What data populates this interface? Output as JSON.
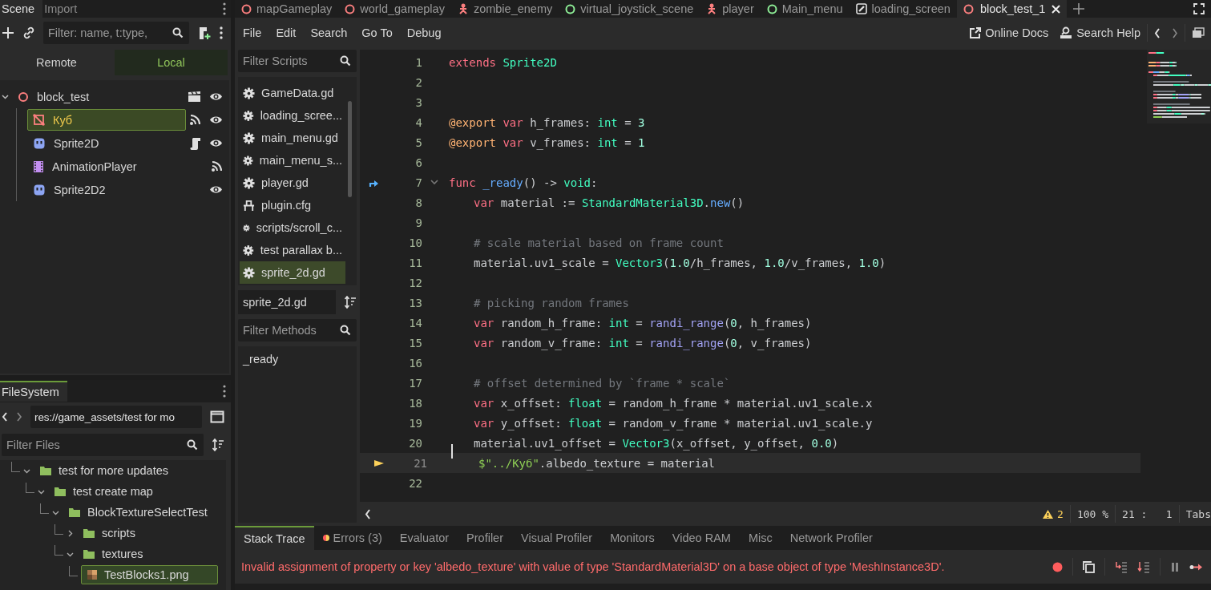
{
  "scene_dock": {
    "tabs": [
      {
        "label": "Scene",
        "selected": true
      },
      {
        "label": "Import",
        "selected": false
      }
    ],
    "filter": {
      "placeholder": "Filter: name, t:type,"
    },
    "mode_tabs": [
      {
        "label": "Remote",
        "selected": false
      },
      {
        "label": "Local",
        "selected": true
      }
    ],
    "tree": [
      {
        "label": "block_test",
        "kind": "root",
        "expanded": true,
        "selected": false,
        "instance": true,
        "signals": false,
        "script": false,
        "visible": true,
        "children": [
          {
            "label": "Куб",
            "kind": "mesh",
            "selected": true,
            "instance": false,
            "signals": true,
            "script": false,
            "visible": true
          },
          {
            "label": "Sprite2D",
            "kind": "sprite",
            "selected": false,
            "instance": false,
            "signals": false,
            "script": true,
            "visible": true
          },
          {
            "label": "AnimationPlayer",
            "kind": "animation",
            "selected": false,
            "instance": false,
            "signals": true,
            "script": false,
            "visible": false
          },
          {
            "label": "Sprite2D2",
            "kind": "sprite",
            "selected": false,
            "instance": false,
            "signals": false,
            "script": false,
            "visible": true
          }
        ]
      }
    ]
  },
  "filesystem": {
    "title": "FileSystem",
    "path": "res://game_assets/test for mo",
    "filter": {
      "placeholder": "Filter Files"
    },
    "tree": [
      {
        "label": "test for more updates",
        "kind": "folder",
        "expanded": true,
        "selected": false,
        "children": [
          {
            "label": "test create map",
            "kind": "folder",
            "expanded": true,
            "selected": false,
            "children": [
              {
                "label": "BlockTextureSelectTest",
                "kind": "folder",
                "expanded": true,
                "selected": false,
                "children": [
                  {
                    "label": "scripts",
                    "kind": "folder",
                    "expanded": false,
                    "selected": false
                  },
                  {
                    "label": "textures",
                    "kind": "folder",
                    "expanded": true,
                    "selected": false,
                    "children": [
                      {
                        "label": "TestBlocks1.png",
                        "kind": "image",
                        "selected": true
                      }
                    ]
                  }
                ]
              }
            ]
          }
        ]
      }
    ]
  },
  "scene_tabs": [
    {
      "label": "mapGameplay",
      "kind": "spatial",
      "selected": false
    },
    {
      "label": "world_gameplay",
      "kind": "spatial",
      "selected": false
    },
    {
      "label": "zombie_enemy",
      "kind": "character",
      "selected": false
    },
    {
      "label": "virtual_joystick_scene",
      "kind": "control",
      "selected": false
    },
    {
      "label": "player",
      "kind": "character",
      "selected": false
    },
    {
      "label": "Main_menu",
      "kind": "control",
      "selected": false
    },
    {
      "label": "loading_screen",
      "kind": "edit",
      "selected": false
    },
    {
      "label": "block_test_1",
      "kind": "spatial",
      "selected": true
    }
  ],
  "menu": [
    "File",
    "Edit",
    "Search",
    "Go To",
    "Debug"
  ],
  "help_links": [
    {
      "label": "Online Docs",
      "kind": "external"
    },
    {
      "label": "Search Help",
      "kind": "docs"
    }
  ],
  "scripts_panel": {
    "filter": {
      "placeholder": "Filter Scripts"
    },
    "items": [
      {
        "label": "GameData.gd",
        "kind": "script",
        "selected": false
      },
      {
        "label": "loading_scree...",
        "kind": "script",
        "selected": false
      },
      {
        "label": "main_menu.gd",
        "kind": "script",
        "selected": false
      },
      {
        "label": "main_menu_s...",
        "kind": "script",
        "selected": false
      },
      {
        "label": "player.gd",
        "kind": "script",
        "selected": false
      },
      {
        "label": "plugin.cfg",
        "kind": "config",
        "selected": false
      },
      {
        "label": "scripts/scroll_c...",
        "kind": "script",
        "selected": false
      },
      {
        "label": "test parallax b...",
        "kind": "script",
        "selected": false
      },
      {
        "label": "sprite_2d.gd",
        "kind": "script",
        "selected": true
      }
    ],
    "current": "sprite_2d.gd",
    "method_filter": {
      "placeholder": "Filter Methods"
    },
    "methods": [
      "_ready"
    ]
  },
  "editor": {
    "lines": [
      {
        "number": "1",
        "indented": false,
        "fold": false,
        "signal_connected": false,
        "executing": false,
        "tokens": [
          {
            "kind": "keyword",
            "text": "extends "
          },
          {
            "kind": "type",
            "text": "Sprite2D"
          }
        ]
      },
      {
        "number": "2",
        "fold": false,
        "signal_connected": false,
        "executing": false
      },
      {
        "number": "3",
        "fold": false,
        "signal_connected": false,
        "executing": false
      },
      {
        "number": "4",
        "indented": false,
        "fold": false,
        "signal_connected": false,
        "executing": false,
        "tokens": [
          {
            "kind": "annotation",
            "text": "@export "
          },
          {
            "kind": "keyword",
            "text": "var "
          },
          {
            "kind": "plain",
            "text": "h_frames: "
          },
          {
            "kind": "type",
            "text": "int"
          },
          {
            "kind": "plain",
            "text": " = "
          },
          {
            "kind": "number",
            "text": "3"
          }
        ]
      },
      {
        "number": "5",
        "indented": false,
        "fold": false,
        "signal_connected": false,
        "executing": false,
        "tokens": [
          {
            "kind": "annotation",
            "text": "@export "
          },
          {
            "kind": "keyword",
            "text": "var "
          },
          {
            "kind": "plain",
            "text": "v_frames: "
          },
          {
            "kind": "type",
            "text": "int"
          },
          {
            "kind": "plain",
            "text": " = "
          },
          {
            "kind": "number",
            "text": "1"
          }
        ]
      },
      {
        "number": "6",
        "fold": false,
        "signal_connected": false,
        "executing": false
      },
      {
        "number": "7",
        "indented": false,
        "fold": true,
        "signal_connected": true,
        "executing": false,
        "tokens": [
          {
            "kind": "keyword",
            "text": "func "
          },
          {
            "kind": "method",
            "text": "_ready"
          },
          {
            "kind": "plain",
            "text": "() -> "
          },
          {
            "kind": "type",
            "text": "void"
          },
          {
            "kind": "plain",
            "text": ":"
          }
        ]
      },
      {
        "number": "8",
        "indented": true,
        "fold": false,
        "signal_connected": false,
        "executing": false,
        "tokens": [
          {
            "kind": "keyword",
            "text": "var "
          },
          {
            "kind": "plain",
            "text": "material := "
          },
          {
            "kind": "type",
            "text": "StandardMaterial3D"
          },
          {
            "kind": "plain",
            "text": "."
          },
          {
            "kind": "method",
            "text": "new"
          },
          {
            "kind": "plain",
            "text": "()"
          }
        ]
      },
      {
        "number": "9",
        "fold": false,
        "signal_connected": false,
        "executing": false
      },
      {
        "number": "10",
        "indented": true,
        "fold": false,
        "signal_connected": false,
        "executing": false,
        "tokens": [
          {
            "kind": "comment",
            "text": "# scale material based on frame count"
          }
        ]
      },
      {
        "number": "11",
        "indented": true,
        "fold": false,
        "signal_connected": false,
        "executing": false,
        "tokens": [
          {
            "kind": "plain",
            "text": "material.uv1_scale = "
          },
          {
            "kind": "type",
            "text": "Vector3"
          },
          {
            "kind": "plain",
            "text": "("
          },
          {
            "kind": "number",
            "text": "1.0"
          },
          {
            "kind": "plain",
            "text": "/h_frames, "
          },
          {
            "kind": "number",
            "text": "1.0"
          },
          {
            "kind": "plain",
            "text": "/v_frames, "
          },
          {
            "kind": "number",
            "text": "1.0"
          },
          {
            "kind": "plain",
            "text": ")"
          }
        ]
      },
      {
        "number": "12",
        "fold": false,
        "signal_connected": false,
        "executing": false
      },
      {
        "number": "13",
        "indented": true,
        "fold": false,
        "signal_connected": false,
        "executing": false,
        "tokens": [
          {
            "kind": "comment",
            "text": "# picking random frames"
          }
        ]
      },
      {
        "number": "14",
        "indented": true,
        "fold": false,
        "signal_connected": false,
        "executing": false,
        "tokens": [
          {
            "kind": "keyword",
            "text": "var "
          },
          {
            "kind": "plain",
            "text": "random_h_frame: "
          },
          {
            "kind": "type",
            "text": "int"
          },
          {
            "kind": "plain",
            "text": " = "
          },
          {
            "kind": "builtin",
            "text": "randi_range"
          },
          {
            "kind": "plain",
            "text": "("
          },
          {
            "kind": "number",
            "text": "0"
          },
          {
            "kind": "plain",
            "text": ", h_frames)"
          }
        ]
      },
      {
        "number": "15",
        "indented": true,
        "fold": false,
        "signal_connected": false,
        "executing": false,
        "tokens": [
          {
            "kind": "keyword",
            "text": "var "
          },
          {
            "kind": "plain",
            "text": "random_v_frame: "
          },
          {
            "kind": "type",
            "text": "int"
          },
          {
            "kind": "plain",
            "text": " = "
          },
          {
            "kind": "builtin",
            "text": "randi_range"
          },
          {
            "kind": "plain",
            "text": "("
          },
          {
            "kind": "number",
            "text": "0"
          },
          {
            "kind": "plain",
            "text": ", v_frames)"
          }
        ]
      },
      {
        "number": "16",
        "fold": false,
        "signal_connected": false,
        "executing": false
      },
      {
        "number": "17",
        "indented": true,
        "fold": false,
        "signal_connected": false,
        "executing": false,
        "tokens": [
          {
            "kind": "comment",
            "text": "# offset determined by `frame * scale`"
          }
        ]
      },
      {
        "number": "18",
        "indented": true,
        "fold": false,
        "signal_connected": false,
        "executing": false,
        "tokens": [
          {
            "kind": "keyword",
            "text": "var "
          },
          {
            "kind": "plain",
            "text": "x_offset: "
          },
          {
            "kind": "type",
            "text": "float"
          },
          {
            "kind": "plain",
            "text": " = random_h_frame * material.uv1_scale.x"
          }
        ]
      },
      {
        "number": "19",
        "indented": true,
        "fold": false,
        "signal_connected": false,
        "executing": false,
        "tokens": [
          {
            "kind": "keyword",
            "text": "var "
          },
          {
            "kind": "plain",
            "text": "y_offset: "
          },
          {
            "kind": "type",
            "text": "float"
          },
          {
            "kind": "plain",
            "text": " = random_v_frame * material.uv1_scale.y"
          }
        ]
      },
      {
        "number": "20",
        "indented": true,
        "fold": false,
        "signal_connected": false,
        "executing": false,
        "tokens": [
          {
            "kind": "plain",
            "text": "material.uv1_offset = "
          },
          {
            "kind": "type",
            "text": "Vector3"
          },
          {
            "kind": "plain",
            "text": "(x_offset, y_offset, "
          },
          {
            "kind": "number",
            "text": "0.0"
          },
          {
            "kind": "plain",
            "text": ")"
          }
        ]
      },
      {
        "number": "21",
        "indented": true,
        "fold": false,
        "signal_connected": false,
        "executing": true,
        "tokens": [
          {
            "kind": "string",
            "text": "$\"../Куб\""
          },
          {
            "kind": "plain",
            "text": ".albedo_texture = material"
          }
        ]
      },
      {
        "number": "22",
        "fold": false,
        "signal_connected": false,
        "executing": false
      }
    ]
  },
  "status_bar": {
    "warnings": "2",
    "zoom": "100 %",
    "position": "21 :   1",
    "indent_mode": "Tabs"
  },
  "bottom_panel": {
    "tabs": [
      {
        "label": "Stack Trace",
        "selected": true,
        "alert": false
      },
      {
        "label": "Errors (3)",
        "selected": false,
        "alert": true
      },
      {
        "label": "Evaluator",
        "selected": false,
        "alert": false
      },
      {
        "label": "Profiler",
        "selected": false,
        "alert": false
      },
      {
        "label": "Visual Profiler",
        "selected": false,
        "alert": false
      },
      {
        "label": "Monitors",
        "selected": false,
        "alert": false
      },
      {
        "label": "Video RAM",
        "selected": false,
        "alert": false
      },
      {
        "label": "Misc",
        "selected": false,
        "alert": false
      },
      {
        "label": "Network Profiler",
        "selected": false,
        "alert": false
      }
    ],
    "message": "Invalid assignment of property or key 'albedo_texture' with value of type 'StandardMaterial3D' on a base object of type 'MeshInstance3D'."
  }
}
